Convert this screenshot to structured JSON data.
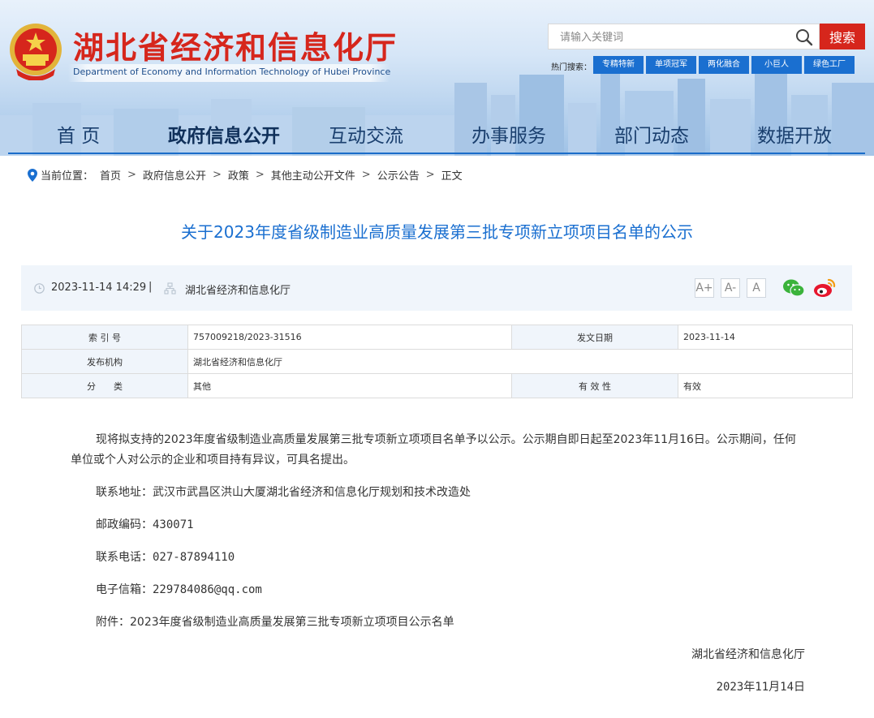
{
  "header": {
    "site_title": "湖北省经济和信息化厅",
    "site_subtitle": "Department of Economy and Information Technology of Hubei Province",
    "search_placeholder": "请输入关键词",
    "search_button": "搜索",
    "hot_label": "热门搜索：",
    "hot_tags": [
      "专精特新",
      "单项冠军",
      "两化融合",
      "小巨人",
      "绿色工厂"
    ]
  },
  "nav": {
    "items": [
      "首 页",
      "政府信息公开",
      "互动交流",
      "办事服务",
      "部门动态",
      "数据开放"
    ],
    "active": "政府信息公开"
  },
  "breadcrumb": {
    "label": "当前位置：",
    "items": [
      "首页",
      "政府信息公开",
      "政策",
      "其他主动公开文件",
      "公示公告",
      "正文"
    ],
    "separator": ">"
  },
  "article": {
    "title": "关于2023年度省级制造业高质量发展第三批专项新立项项目名单的公示",
    "publish_time": "2023-11-14 14:29",
    "meta_divider": "|",
    "source": "湖北省经济和信息化厅",
    "font_sizes": [
      "A+",
      "A-",
      "A"
    ]
  },
  "info_table": {
    "index_label": "索 引 号",
    "index_value": "757009218/2023-31516",
    "date_label": "发文日期",
    "date_value": "2023-11-14",
    "org_label": "发布机构",
    "org_value": "湖北省经济和信息化厅",
    "category_label": "分　　类",
    "category_value": "其他",
    "validity_label": "有 效 性",
    "validity_value": "有效"
  },
  "body": {
    "intro": "现将拟支持的2023年度省级制造业高质量发展第三批专项新立项项目名单予以公示。公示期自即日起至2023年11月16日。公示期间，任何单位或个人对公示的企业和项目持有异议，可具名提出。",
    "address_label": "联系地址：",
    "address": "武汉市武昌区洪山大厦湖北省经济和信息化厅规划和技术改造处",
    "postcode_label": "邮政编码：",
    "postcode": "430071",
    "phone_label": "联系电话：",
    "phone": "027-87894110",
    "email_label": "电子信箱：",
    "email": "229784086@qq.com",
    "attachment_label": "附件：",
    "attachment": "2023年度省级制造业高质量发展第三批专项新立项项目公示名单",
    "signature": "湖北省经济和信息化厅",
    "sign_date": "2023年11月14日"
  },
  "colors": {
    "brand_red": "#d6261c",
    "link_blue": "#1a6fd0",
    "nav_text": "#1a3f6e"
  }
}
